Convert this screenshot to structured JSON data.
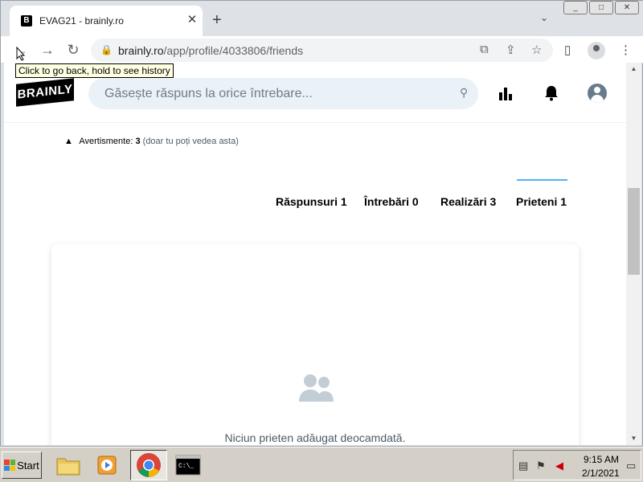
{
  "browser": {
    "tab_title": "EVAG21 - brainly.ro",
    "tab_favicon": "B",
    "close_glyph": "✕",
    "newtab_glyph": "+",
    "url_host": "brainly.ro",
    "url_path": "/app/profile/4033806/friends",
    "tooltip": "Click to go back, hold to see history",
    "icons": [
      "back-arrow-icon",
      "forward-arrow-icon",
      "reload-icon",
      "lock-icon",
      "translate-icon",
      "share-icon",
      "bookmark-star-icon",
      "side-panel-icon",
      "profile-icon",
      "menu-icon"
    ]
  },
  "site": {
    "logo": "BRAINLY",
    "search_placeholder": "Găsește răspuns la orice întrebare...",
    "warning_label": "Avertismente:",
    "warning_count": "3",
    "warning_note": "(doar tu poți vedea asta)",
    "tabs": [
      {
        "label": "Răspunsuri 1"
      },
      {
        "label": "Întrebări 0"
      },
      {
        "label": "Realizări 3"
      },
      {
        "label": "Prieteni 1",
        "active": true
      }
    ],
    "empty_message": "Niciun prieten adăugat deocamdată.",
    "accent_color": "#4fb3f6"
  },
  "taskbar": {
    "start_label": "Start",
    "time": "9:15 AM",
    "date": "2/1/2021"
  }
}
